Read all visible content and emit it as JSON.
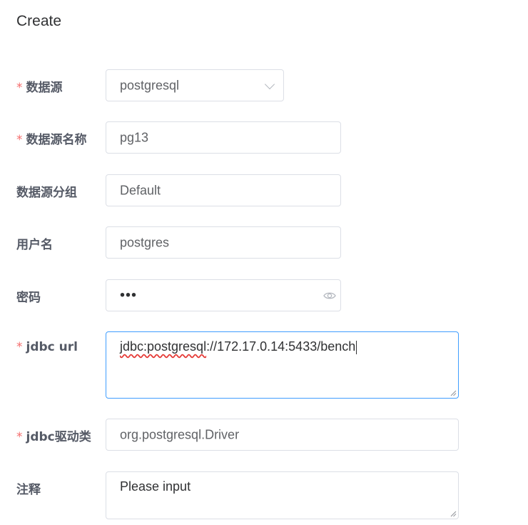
{
  "page": {
    "title": "Create"
  },
  "form": {
    "datasource": {
      "label": "数据源",
      "required": true,
      "value": "postgresql"
    },
    "datasource_name": {
      "label": "数据源名称",
      "required": true,
      "value": "pg13"
    },
    "datasource_group": {
      "label": "数据源分组",
      "required": false,
      "value": "Default"
    },
    "username": {
      "label": "用户名",
      "required": false,
      "value": "postgres"
    },
    "password": {
      "label": "密码",
      "required": false,
      "value": "•••"
    },
    "jdbc_url": {
      "label": "jdbc url",
      "required": true,
      "value_prefix": "jdbc:postgresql",
      "value_rest": "://172.17.0.14:5433/bench"
    },
    "jdbc_driver": {
      "label": "jdbc驱动类",
      "required": true,
      "value": "org.postgresql.Driver"
    },
    "comment": {
      "label": "注释",
      "required": false,
      "placeholder": "Please input"
    }
  },
  "colors": {
    "required": "#f56c6c",
    "focus_border": "#409eff",
    "border": "#dcdfe6",
    "placeholder": "#c0c4cc"
  },
  "required_mark": "*",
  "icons": {
    "select": "chevron-down-icon",
    "password": "eye-icon",
    "textarea": "resize-handle-icon"
  }
}
